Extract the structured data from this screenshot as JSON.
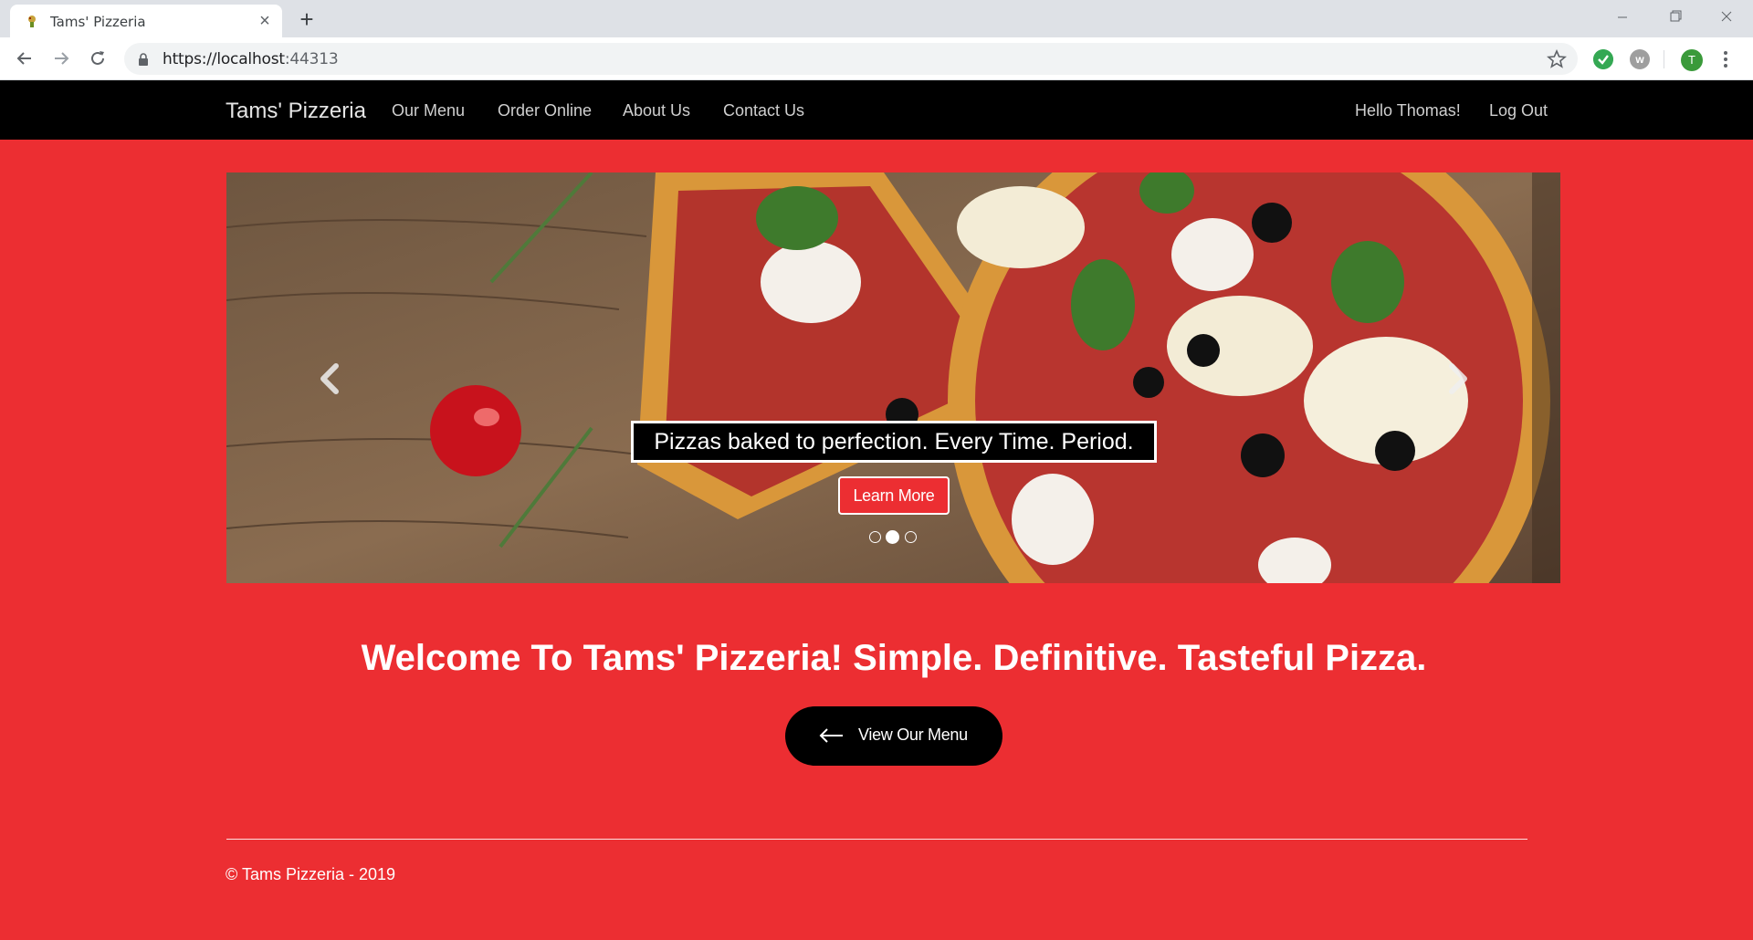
{
  "browser": {
    "tab_title": "Tams' Pizzeria",
    "url_host": "https://localhost",
    "url_port": ":44313",
    "avatar_letter": "T",
    "extension_w": "w"
  },
  "navbar": {
    "brand": "Tams' Pizzeria",
    "links": [
      "Our Menu",
      "Order Online",
      "About Us",
      "Contact Us"
    ],
    "greeting": "Hello Thomas!",
    "logout": "Log Out"
  },
  "carousel": {
    "caption": "Pizzas baked to perfection. Every Time. Period.",
    "button_label": "Learn More",
    "slide_count": 3,
    "active_slide": 2
  },
  "main": {
    "welcome": "Welcome To Tams' Pizzeria! Simple. Definitive. Tasteful Pizza.",
    "menu_button": "View Our Menu"
  },
  "footer": {
    "copyright": "© Tams Pizzeria - 2019"
  },
  "colors": {
    "page_background": "#ec2e32",
    "navbar_background": "#000000",
    "button_black": "#000000"
  }
}
